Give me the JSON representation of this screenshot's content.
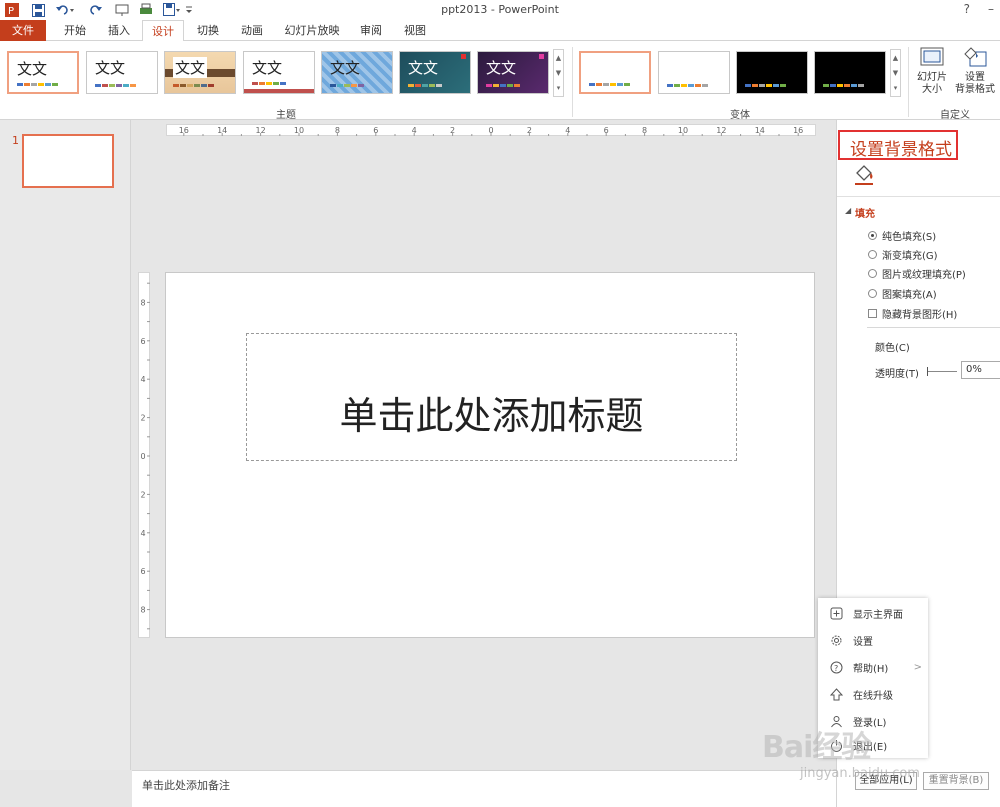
{
  "app": {
    "title": "ppt2013 - PowerPoint",
    "help": "?",
    "minimize": "–"
  },
  "tabs": [
    {
      "label": "文件"
    },
    {
      "label": "开始"
    },
    {
      "label": "插入"
    },
    {
      "label": "设计"
    },
    {
      "label": "切换"
    },
    {
      "label": "动画"
    },
    {
      "label": "幻灯片放映"
    },
    {
      "label": "审阅"
    },
    {
      "label": "视图"
    }
  ],
  "ribbon": {
    "themes_label": "主题",
    "variants_label": "变体",
    "customize_label": "自定义",
    "theme_text": "文文",
    "slide_size_label": "幻灯片\n大小",
    "format_bg_label": "设置\n背景格式"
  },
  "slide_panel": {
    "slide_number": "1"
  },
  "slide": {
    "title_placeholder": "单击此处添加标题"
  },
  "notes": {
    "placeholder": "单击此处添加备注"
  },
  "format_pane": {
    "title": "设置背景格式",
    "fill_section": "填充",
    "options": [
      {
        "label": "纯色填充(S)",
        "selected": true
      },
      {
        "label": "渐变填充(G)",
        "selected": false
      },
      {
        "label": "图片或纹理填充(P)",
        "selected": false
      },
      {
        "label": "图案填充(A)",
        "selected": false
      }
    ],
    "hide_bg_graphics": "隐藏背景图形(H)",
    "color_label": "颜色(C)",
    "transparency_label": "透明度(T)",
    "transparency_value": "0%",
    "apply_all": "全部应用(L)",
    "reset_bg": "重置背景(B)"
  },
  "popup_menu": [
    {
      "label": "显示主界面",
      "icon": "plus-square-icon"
    },
    {
      "label": "设置",
      "icon": "gear-icon"
    },
    {
      "label": "帮助(H)",
      "icon": "question-icon",
      "submenu": true
    },
    {
      "label": "在线升级",
      "icon": "upload-arrow-icon"
    },
    {
      "label": "登录(L)",
      "icon": "user-icon"
    },
    {
      "label": "退出(E)",
      "icon": "power-icon"
    }
  ],
  "watermark": {
    "text": "Bai经验",
    "url": "jingyan.baidu.com"
  },
  "colors": {
    "accent": "#c43e1c",
    "highlight_box": "#e23131"
  }
}
